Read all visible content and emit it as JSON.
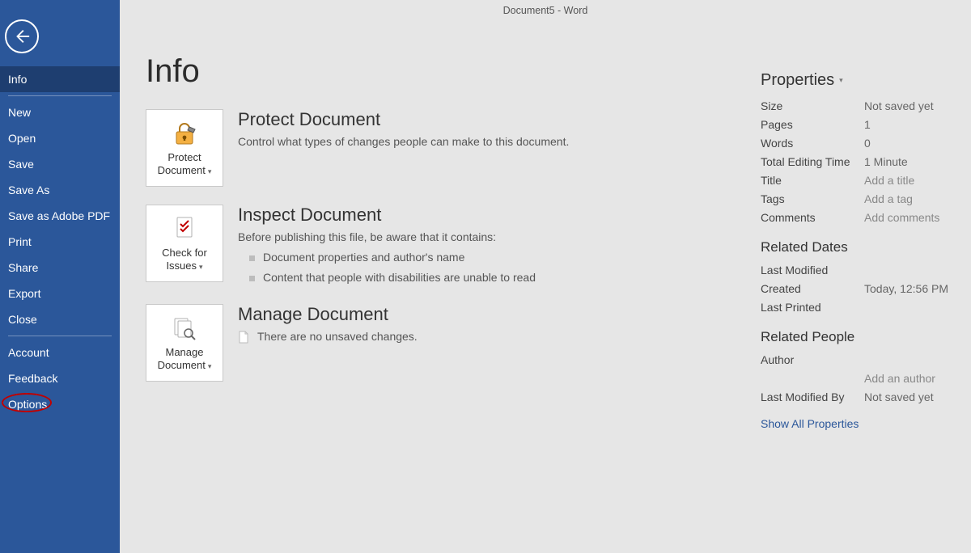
{
  "window": {
    "title": "Document5  -  Word"
  },
  "sidebar": {
    "items": [
      {
        "label": "Info"
      },
      {
        "label": "New"
      },
      {
        "label": "Open"
      },
      {
        "label": "Save"
      },
      {
        "label": "Save As"
      },
      {
        "label": "Save as Adobe PDF"
      },
      {
        "label": "Print"
      },
      {
        "label": "Share"
      },
      {
        "label": "Export"
      },
      {
        "label": "Close"
      },
      {
        "label": "Account"
      },
      {
        "label": "Feedback"
      },
      {
        "label": "Options"
      }
    ]
  },
  "page": {
    "title": "Info"
  },
  "sections": {
    "protect": {
      "tile_label": "Protect Document",
      "title": "Protect Document",
      "desc": "Control what types of changes people can make to this document."
    },
    "inspect": {
      "tile_label": "Check for Issues",
      "title": "Inspect Document",
      "desc": "Before publishing this file, be aware that it contains:",
      "items": [
        "Document properties and author's name",
        "Content that people with disabilities are unable to read"
      ]
    },
    "manage": {
      "tile_label": "Manage Document",
      "title": "Manage Document",
      "desc": "There are no unsaved changes."
    }
  },
  "properties": {
    "heading": "Properties",
    "rows": {
      "size": {
        "label": "Size",
        "value": "Not saved yet"
      },
      "pages": {
        "label": "Pages",
        "value": "1"
      },
      "words": {
        "label": "Words",
        "value": "0"
      },
      "editing_time": {
        "label": "Total Editing Time",
        "value": "1 Minute"
      },
      "title": {
        "label": "Title",
        "value": "Add a title"
      },
      "tags": {
        "label": "Tags",
        "value": "Add a tag"
      },
      "comments": {
        "label": "Comments",
        "value": "Add comments"
      }
    },
    "related_dates": {
      "heading": "Related Dates",
      "last_modified": {
        "label": "Last Modified",
        "value": ""
      },
      "created": {
        "label": "Created",
        "value": "Today, 12:56 PM"
      },
      "last_printed": {
        "label": "Last Printed",
        "value": ""
      }
    },
    "related_people": {
      "heading": "Related People",
      "author": {
        "label": "Author",
        "value": ""
      },
      "add_author": "Add an author",
      "last_modified_by": {
        "label": "Last Modified By",
        "value": "Not saved yet"
      }
    },
    "show_all": "Show All Properties"
  }
}
